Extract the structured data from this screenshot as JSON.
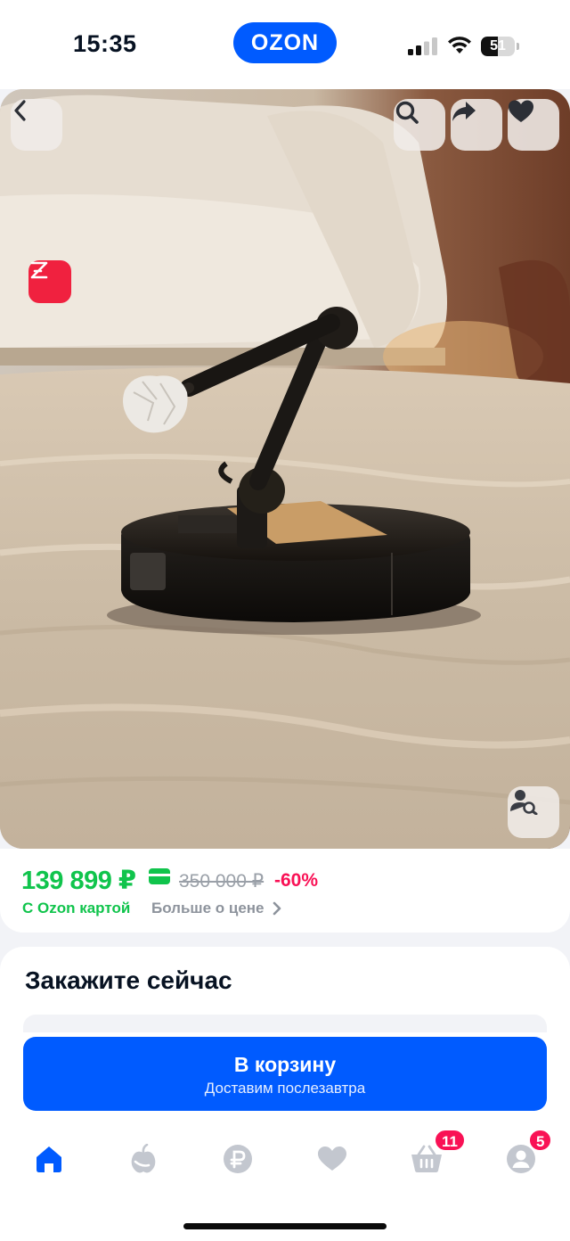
{
  "status_bar": {
    "time": "15:35",
    "battery": "51",
    "battery_level": 0.51
  },
  "header": {
    "logo_text": "OZON"
  },
  "product": {
    "price": "139 899 ₽",
    "old_price": "350 000 ₽",
    "discount": "-60%",
    "ozon_card_label": "С Ozon картой",
    "more_price_label": "Больше о цене"
  },
  "order": {
    "title": "Закажите сейчас",
    "cart_button_label": "В корзину",
    "cart_button_sub": "Доставим послезавтра"
  },
  "tab_bar": {
    "items": [
      {
        "icon": "home-icon",
        "active": true
      },
      {
        "icon": "fresh-icon",
        "active": false
      },
      {
        "icon": "ruble-icon",
        "active": false
      },
      {
        "icon": "favorites-icon",
        "active": false
      },
      {
        "icon": "cart-icon",
        "badge": "11"
      },
      {
        "icon": "profile-icon",
        "badge": "5"
      }
    ]
  },
  "colors": {
    "brand_blue": "#005bff",
    "price_green": "#10c44c",
    "discount_pink": "#f91155",
    "icon_gray": "#c3c7cf"
  }
}
